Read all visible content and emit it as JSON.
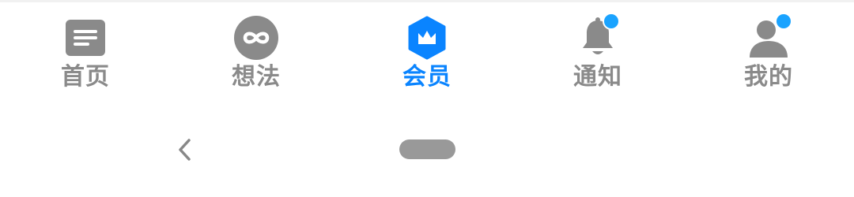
{
  "tabbar": {
    "tabs": [
      {
        "label": "首页",
        "icon": "article-icon",
        "active": false
      },
      {
        "label": "想法",
        "icon": "infinity-icon",
        "active": false
      },
      {
        "label": "会员",
        "icon": "crown-icon",
        "active": true
      },
      {
        "label": "通知",
        "icon": "bell-icon",
        "active": false,
        "badge": true
      },
      {
        "label": "我的",
        "icon": "person-icon",
        "active": false,
        "badge": true
      }
    ],
    "colors": {
      "inactive": "#8a8a8a",
      "active": "#0a84ff",
      "badge": "#1aa3ff"
    }
  },
  "system_nav": {
    "back_icon": "chevron-left-icon",
    "home_icon": "home-pill-icon"
  }
}
